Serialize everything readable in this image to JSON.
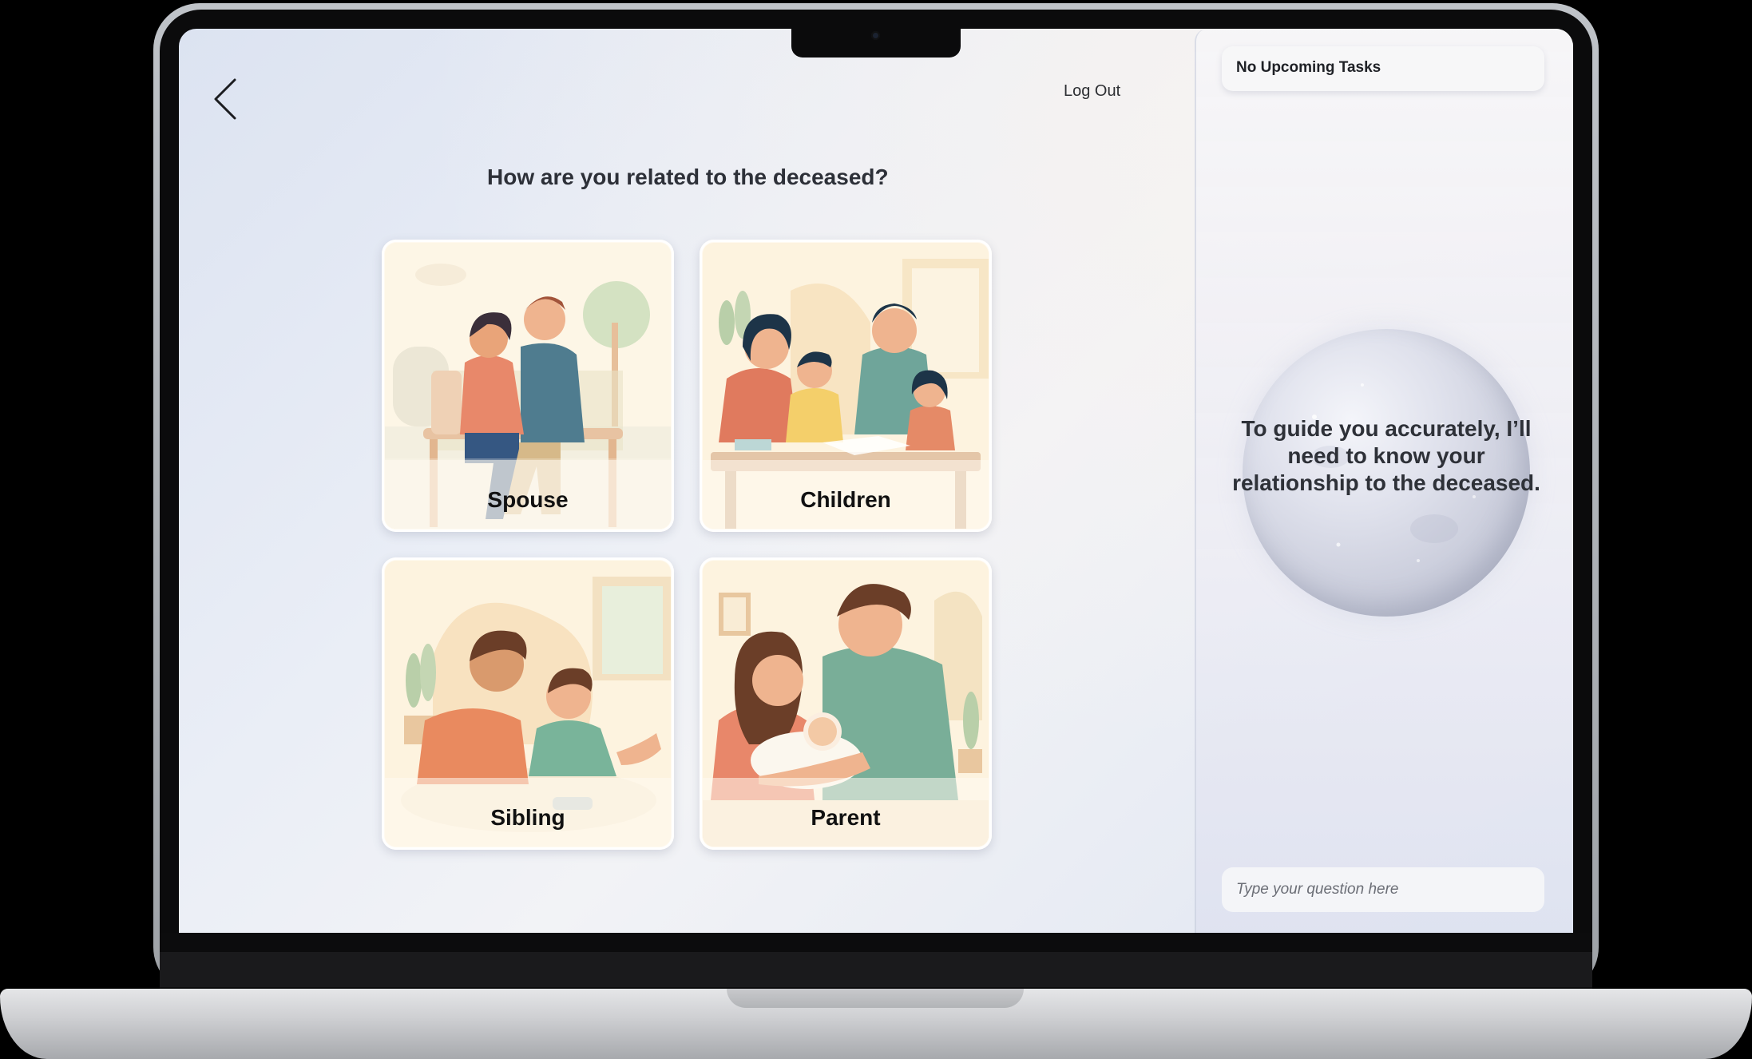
{
  "header": {
    "logout_label": "Log Out"
  },
  "main": {
    "question": "How are you related to the deceased?",
    "options": [
      {
        "label": "Spouse"
      },
      {
        "label": "Children"
      },
      {
        "label": "Sibling"
      },
      {
        "label": "Parent"
      }
    ]
  },
  "panel": {
    "tasks_label": "No Upcoming Tasks",
    "assistant_message": "To guide you accurately, I’ll need to know your relationship to the deceased.",
    "input_placeholder": "Type your question here"
  },
  "icons": {
    "back": "chevron-left-icon"
  }
}
